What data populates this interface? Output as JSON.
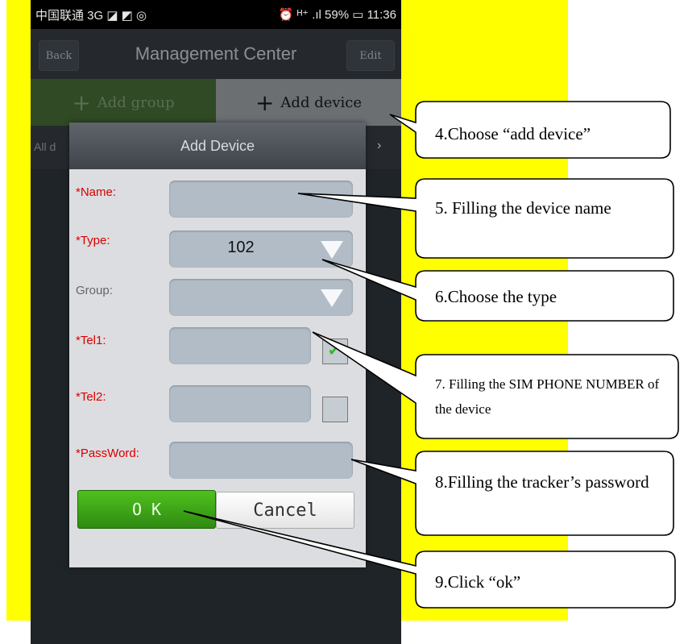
{
  "status_bar": {
    "left": "中国联通 3G ◪ ◩ ◎",
    "right": "⏰ ᴴ⁺ .ıl 59% ▭ 11:36"
  },
  "header": {
    "back_label": "Back",
    "title": "Management Center",
    "edit_label": "Edit"
  },
  "tabs": [
    {
      "label": "Add group"
    },
    {
      "label": "Add device"
    }
  ],
  "list_header": {
    "left_text": "All d",
    "chevron": "›"
  },
  "dialog": {
    "title": "Add Device",
    "fields": {
      "name_label": "*Name:",
      "type_label": "*Type:",
      "type_value": "102",
      "group_label": "Group:",
      "group_value": "",
      "tel1_label": "*Tel1:",
      "tel1_checked": true,
      "tel2_label": "*Tel2:",
      "tel2_checked": false,
      "password_label": "*PassWord:"
    },
    "ok_label": "O K",
    "cancel_label": "Cancel"
  },
  "callouts": [
    {
      "text": "4.Choose “add device”"
    },
    {
      "text": "5. Filling the device name"
    },
    {
      "text": "6.Choose the type"
    },
    {
      "text": "7. Filling the SIM PHONE NUMBER of the device"
    },
    {
      "text": "8.Filling the tracker’s password"
    },
    {
      "text": "9.Click “ok”"
    }
  ],
  "colors": {
    "highlight": "#ffff00",
    "required_label": "#d80000",
    "ok_button": "#3fa51a"
  },
  "icons": [
    "plus-icon",
    "chevron-right-icon",
    "dropdown-arrow-icon",
    "checkmark-icon"
  ]
}
